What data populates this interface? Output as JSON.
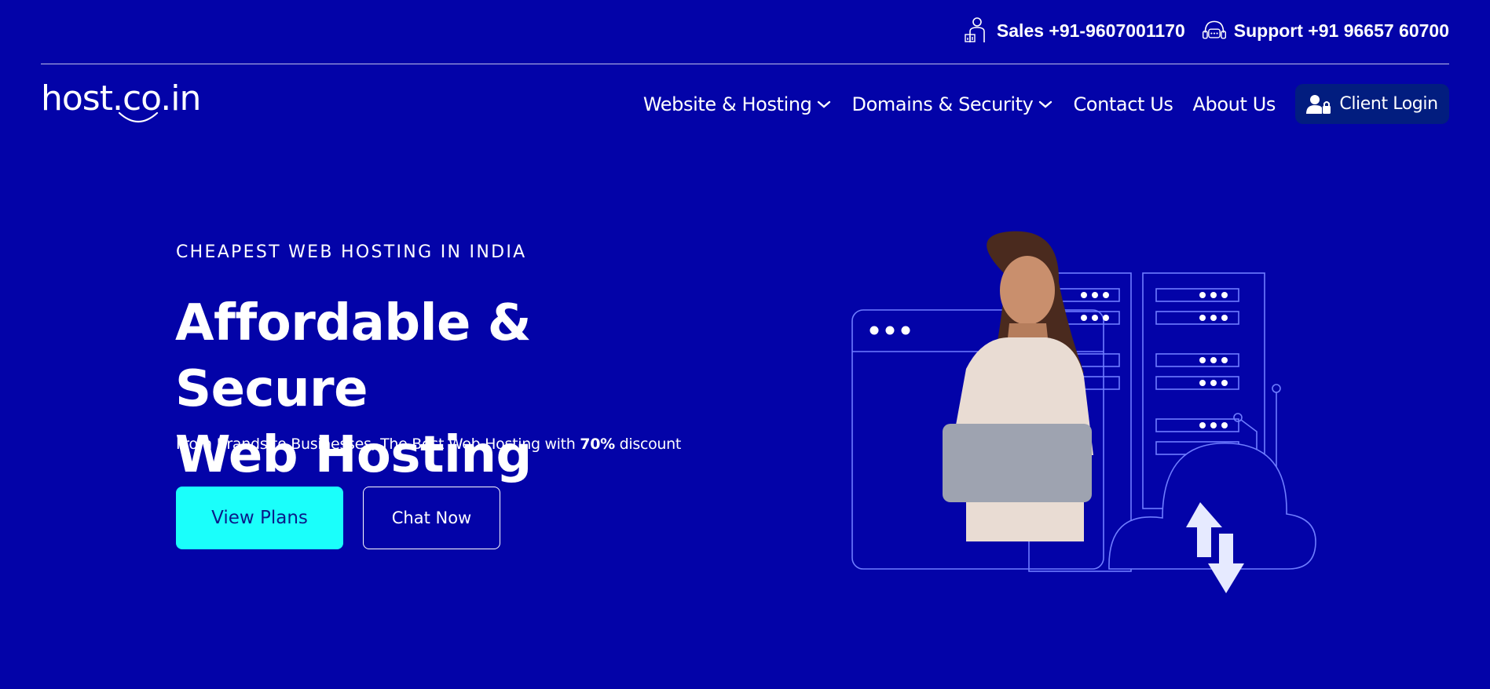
{
  "header": {
    "sales": {
      "label": "Sales +91-9607001170",
      "icon": "sales-person-icon"
    },
    "support": {
      "label": "Support +91 96657 60700",
      "icon": "headset-icon"
    }
  },
  "logo": {
    "text": "host.co.in"
  },
  "nav": {
    "items": [
      {
        "label": "Website & Hosting",
        "has_dropdown": true
      },
      {
        "label": "Domains & Security",
        "has_dropdown": true
      },
      {
        "label": "Contact Us",
        "has_dropdown": false
      },
      {
        "label": "About Us",
        "has_dropdown": false
      }
    ],
    "login": {
      "label": "Client Login",
      "icon": "user-lock-icon"
    }
  },
  "hero": {
    "eyebrow": "CHEAPEST WEB HOSTING IN INDIA",
    "title_line1": "Affordable & Secure",
    "title_line2": "Web Hosting",
    "subtitle_pre": "From Brands to Businesses, The Best Web Hosting with ",
    "subtitle_bold": "70%",
    "subtitle_post": " discount",
    "primary_cta": "View Plans",
    "secondary_cta": "Chat Now"
  },
  "colors": {
    "background": "#0303a8",
    "accent_cyan": "#1afffb",
    "login_bg": "#021d7f",
    "text": "#ffffff"
  }
}
